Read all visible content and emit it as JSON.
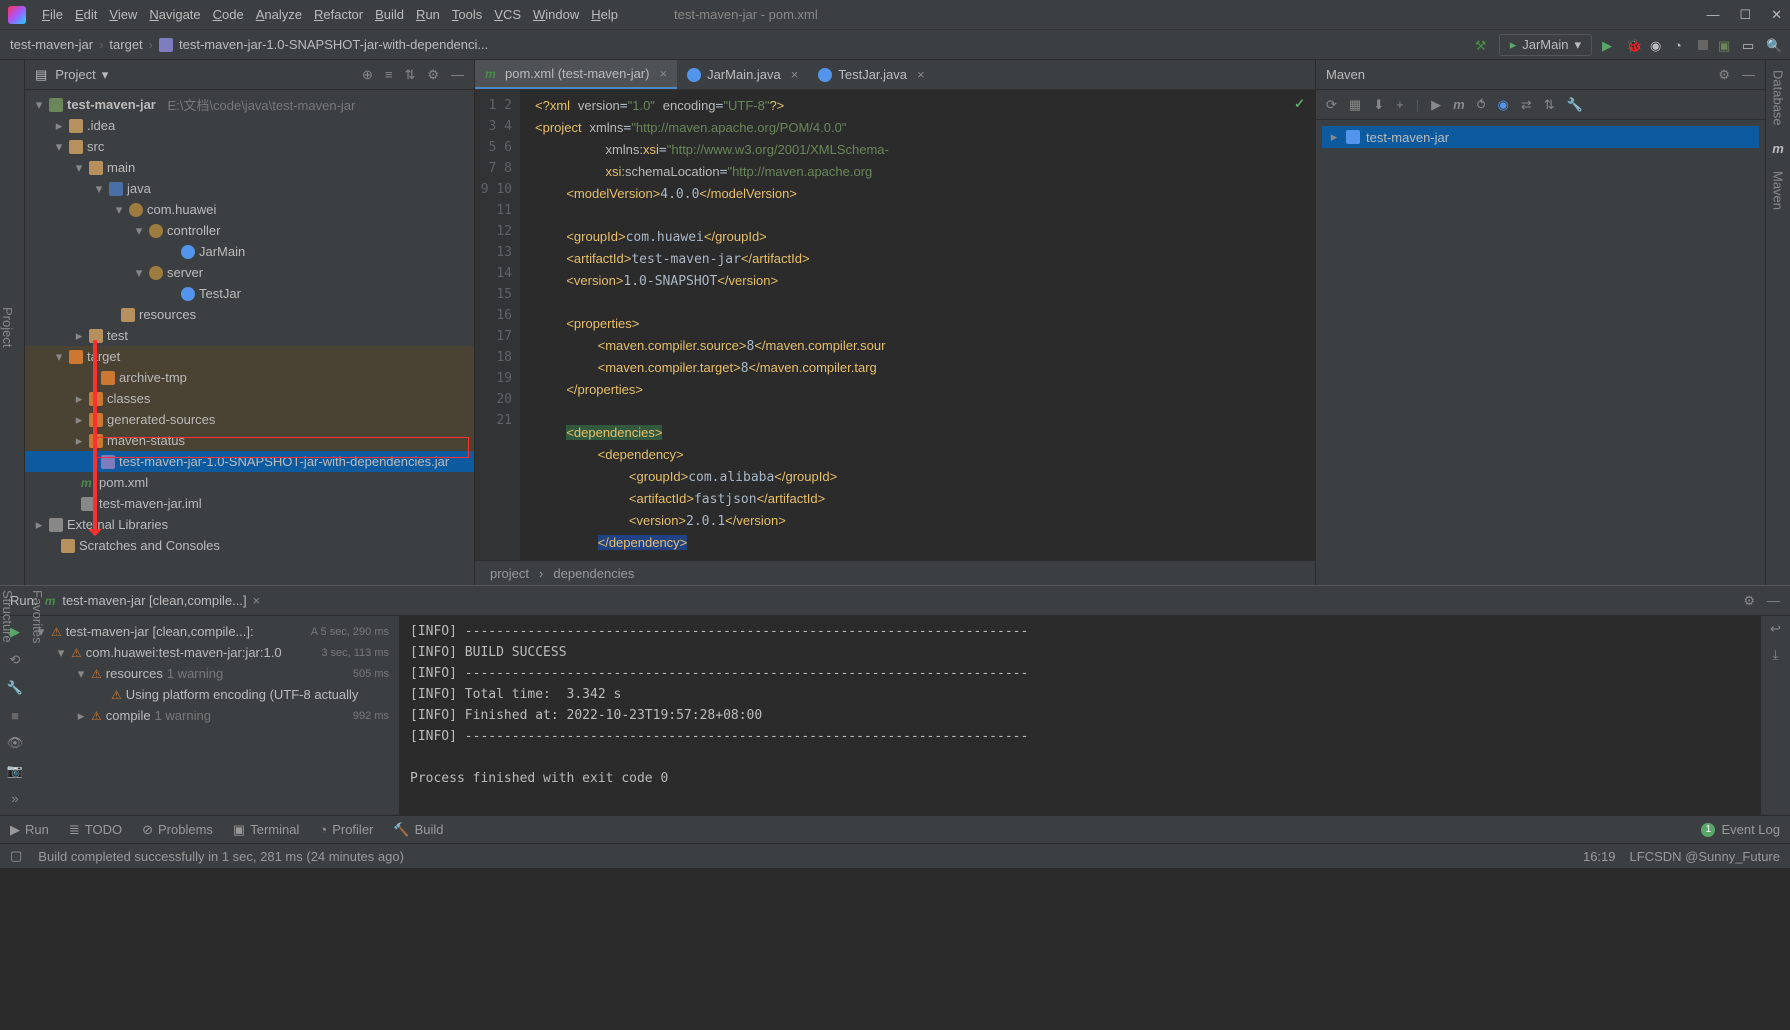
{
  "window_title": "test-maven-jar - pom.xml",
  "menu": [
    "File",
    "Edit",
    "View",
    "Navigate",
    "Code",
    "Analyze",
    "Refactor",
    "Build",
    "Run",
    "Tools",
    "VCS",
    "Window",
    "Help"
  ],
  "breadcrumb": {
    "project": "test-maven-jar",
    "folder": "target",
    "file": "test-maven-jar-1.0-SNAPSHOT-jar-with-dependenci..."
  },
  "run_config": "JarMain",
  "project_panel": {
    "title": "Project",
    "root_name": "test-maven-jar",
    "root_path": "E:\\文档\\code\\java\\test-maven-jar",
    "nodes": {
      "idea": ".idea",
      "src": "src",
      "main": "main",
      "java": "java",
      "pkg": "com.huawei",
      "controller": "controller",
      "jarmain": "JarMain",
      "server": "server",
      "testjar": "TestJar",
      "resources": "resources",
      "test": "test",
      "target": "target",
      "archive": "archive-tmp",
      "classes": "classes",
      "gensrc": "generated-sources",
      "mavenstatus": "maven-status",
      "jarfile": "test-maven-jar-1.0-SNAPSHOT-jar-with-dependencies.jar",
      "pom": "pom.xml",
      "iml": "test-maven-jar.iml",
      "ext": "External Libraries",
      "scratch": "Scratches and Consoles"
    }
  },
  "editor_tabs": [
    {
      "name": "pom.xml (test-maven-jar)",
      "icon": "m",
      "active": true
    },
    {
      "name": "JarMain.java",
      "icon": "c",
      "active": false
    },
    {
      "name": "TestJar.java",
      "icon": "c",
      "active": false
    }
  ],
  "code_lines": [
    {
      "n": 1,
      "html": "<span class='tag'>&lt;?xml</span> <span class='attr'>version</span>=<span class='str'>\"1.0\"</span> <span class='attr'>encoding</span>=<span class='str'>\"UTF-8\"</span><span class='tag'>?&gt;</span>"
    },
    {
      "n": 2,
      "html": "<span class='tag'>&lt;project</span> <span class='attr'>xmlns</span>=<span class='str'>\"http://maven.apache.org/POM/4.0.0\"</span>"
    },
    {
      "n": 3,
      "html": "         <span class='attr'>xmlns:</span><span class='tag'>xsi</span>=<span class='str'>\"http://www.w3.org/2001/XMLSchema-</span>"
    },
    {
      "n": 4,
      "html": "         <span class='tag'>xsi</span><span class='attr'>:schemaLocation</span>=<span class='str'>\"http://maven.apache.org</span>"
    },
    {
      "n": 5,
      "html": "    <span class='tag'>&lt;modelVersion&gt;</span>4.0.0<span class='tag'>&lt;/modelVersion&gt;</span>"
    },
    {
      "n": 6,
      "html": ""
    },
    {
      "n": 7,
      "html": "    <span class='tag'>&lt;groupId&gt;</span>com.huawei<span class='tag'>&lt;/groupId&gt;</span>"
    },
    {
      "n": 8,
      "html": "    <span class='tag'>&lt;artifactId&gt;</span>test-maven-jar<span class='tag'>&lt;/artifactId&gt;</span>"
    },
    {
      "n": 9,
      "html": "    <span class='tag'>&lt;version&gt;</span>1.0-SNAPSHOT<span class='tag'>&lt;/version&gt;</span>"
    },
    {
      "n": 10,
      "html": ""
    },
    {
      "n": 11,
      "html": "    <span class='tag'>&lt;properties&gt;</span>"
    },
    {
      "n": 12,
      "html": "        <span class='tag'>&lt;maven.compiler.source&gt;</span>8<span class='tag'>&lt;/maven.compiler.sour</span>"
    },
    {
      "n": 13,
      "html": "        <span class='tag'>&lt;maven.compiler.target&gt;</span>8<span class='tag'>&lt;/maven.compiler.targ</span>"
    },
    {
      "n": 14,
      "html": "    <span class='tag'>&lt;/properties&gt;</span>"
    },
    {
      "n": 15,
      "html": ""
    },
    {
      "n": 16,
      "html": "    <span class='hl2 tag'>&lt;dependencies&gt;</span>"
    },
    {
      "n": 17,
      "html": "        <span class='tag'>&lt;dependency&gt;</span>"
    },
    {
      "n": 18,
      "html": "            <span class='tag'>&lt;groupId&gt;</span>com.alibaba<span class='tag'>&lt;/groupId&gt;</span>"
    },
    {
      "n": 19,
      "html": "            <span class='tag'>&lt;artifactId&gt;</span>fastjson<span class='tag'>&lt;/artifactId&gt;</span>"
    },
    {
      "n": 20,
      "html": "            <span class='tag'>&lt;version&gt;</span>2.0.1<span class='tag'>&lt;/version&gt;</span>"
    },
    {
      "n": 21,
      "html": "        <span class='hl tag'>&lt;/dependency&gt;</span>"
    }
  ],
  "editor_breadcrumb": [
    "project",
    "dependencies"
  ],
  "maven": {
    "title": "Maven",
    "project": "test-maven-jar"
  },
  "run_panel": {
    "label": "Run:",
    "tab": "test-maven-jar [clean,compile...]",
    "tree": [
      {
        "indent": 0,
        "arrow": "dn",
        "icon": "warn",
        "text": "test-maven-jar [clean,compile...]:",
        "extra": "A 5 sec, 290 ms"
      },
      {
        "indent": 1,
        "arrow": "dn",
        "icon": "warn",
        "text": "com.huawei:test-maven-jar:jar:1.0",
        "extra": "3 sec, 113 ms"
      },
      {
        "indent": 2,
        "arrow": "dn",
        "icon": "warn",
        "text": "resources",
        "sub": "1 warning",
        "extra": "505 ms"
      },
      {
        "indent": 3,
        "arrow": "no",
        "icon": "warn",
        "text": "Using platform encoding (UTF-8 actually",
        "extra": ""
      },
      {
        "indent": 2,
        "arrow": "rt",
        "icon": "warn",
        "text": "compile",
        "sub": "1 warning",
        "extra": "992 ms"
      }
    ],
    "console": [
      "[INFO] ------------------------------------------------------------------------",
      "[INFO] BUILD SUCCESS",
      "[INFO] ------------------------------------------------------------------------",
      "[INFO] Total time:  3.342 s",
      "[INFO] Finished at: 2022-10-23T19:57:28+08:00",
      "[INFO] ------------------------------------------------------------------------",
      "",
      "Process finished with exit code 0"
    ]
  },
  "bottom_tabs": [
    "Run",
    "TODO",
    "Problems",
    "Terminal",
    "Profiler",
    "Build"
  ],
  "event_log": "Event Log",
  "status": "Build completed successfully in 1 sec, 281 ms (24 minutes ago)",
  "clock": "16:19",
  "watermark": "LFCSDN @Sunny_Future"
}
